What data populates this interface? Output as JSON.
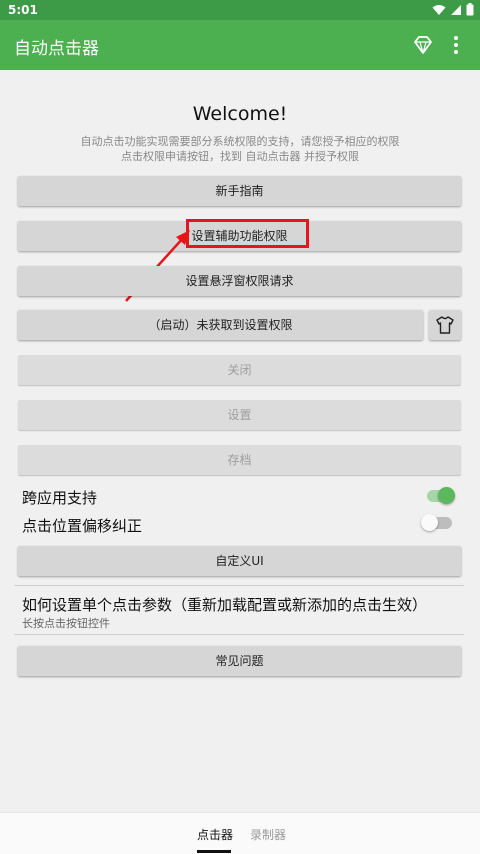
{
  "status_bar": {
    "time": "5:01",
    "icons": [
      "wifi-icon",
      "signal-icon",
      "battery-icon"
    ]
  },
  "app_bar": {
    "title": "自动点击器",
    "actions": [
      "diamond-icon",
      "more-vert-icon"
    ]
  },
  "header": {
    "welcome": "Welcome!",
    "description_line1": "自动点击功能实现需要部分系统权限的支持，请您授予相应的权限",
    "description_line2": "点击权限申请按钮，找到 自动点击器 并授予权限"
  },
  "buttons": {
    "guide": "新手指南",
    "accessibility": "设置辅助功能权限",
    "overlay": "设置悬浮窗权限请求",
    "start": "（启动）未获取到设置权限",
    "close": "关闭",
    "settings": "设置",
    "save": "存档",
    "custom_ui": "自定义UI",
    "faq": "常见问题"
  },
  "toggles": {
    "cross_app": {
      "label": "跨应用支持",
      "on": true
    },
    "offset_correction": {
      "label": "点击位置偏移纠正",
      "on": false
    }
  },
  "help": {
    "title": "如何设置单个点击参数（重新加载配置或新添加的点击生效）",
    "subtitle": "长按点击按钮控件"
  },
  "bottom_nav": {
    "items": [
      "点击器",
      "录制器"
    ],
    "active": 0
  },
  "colors": {
    "status_bar": "#3d9a47",
    "app_bar": "#4caf50",
    "highlight": "#e8141a",
    "toggle_on_thumb": "#5cb85c",
    "toggle_on_track": "#a5d6a7"
  }
}
